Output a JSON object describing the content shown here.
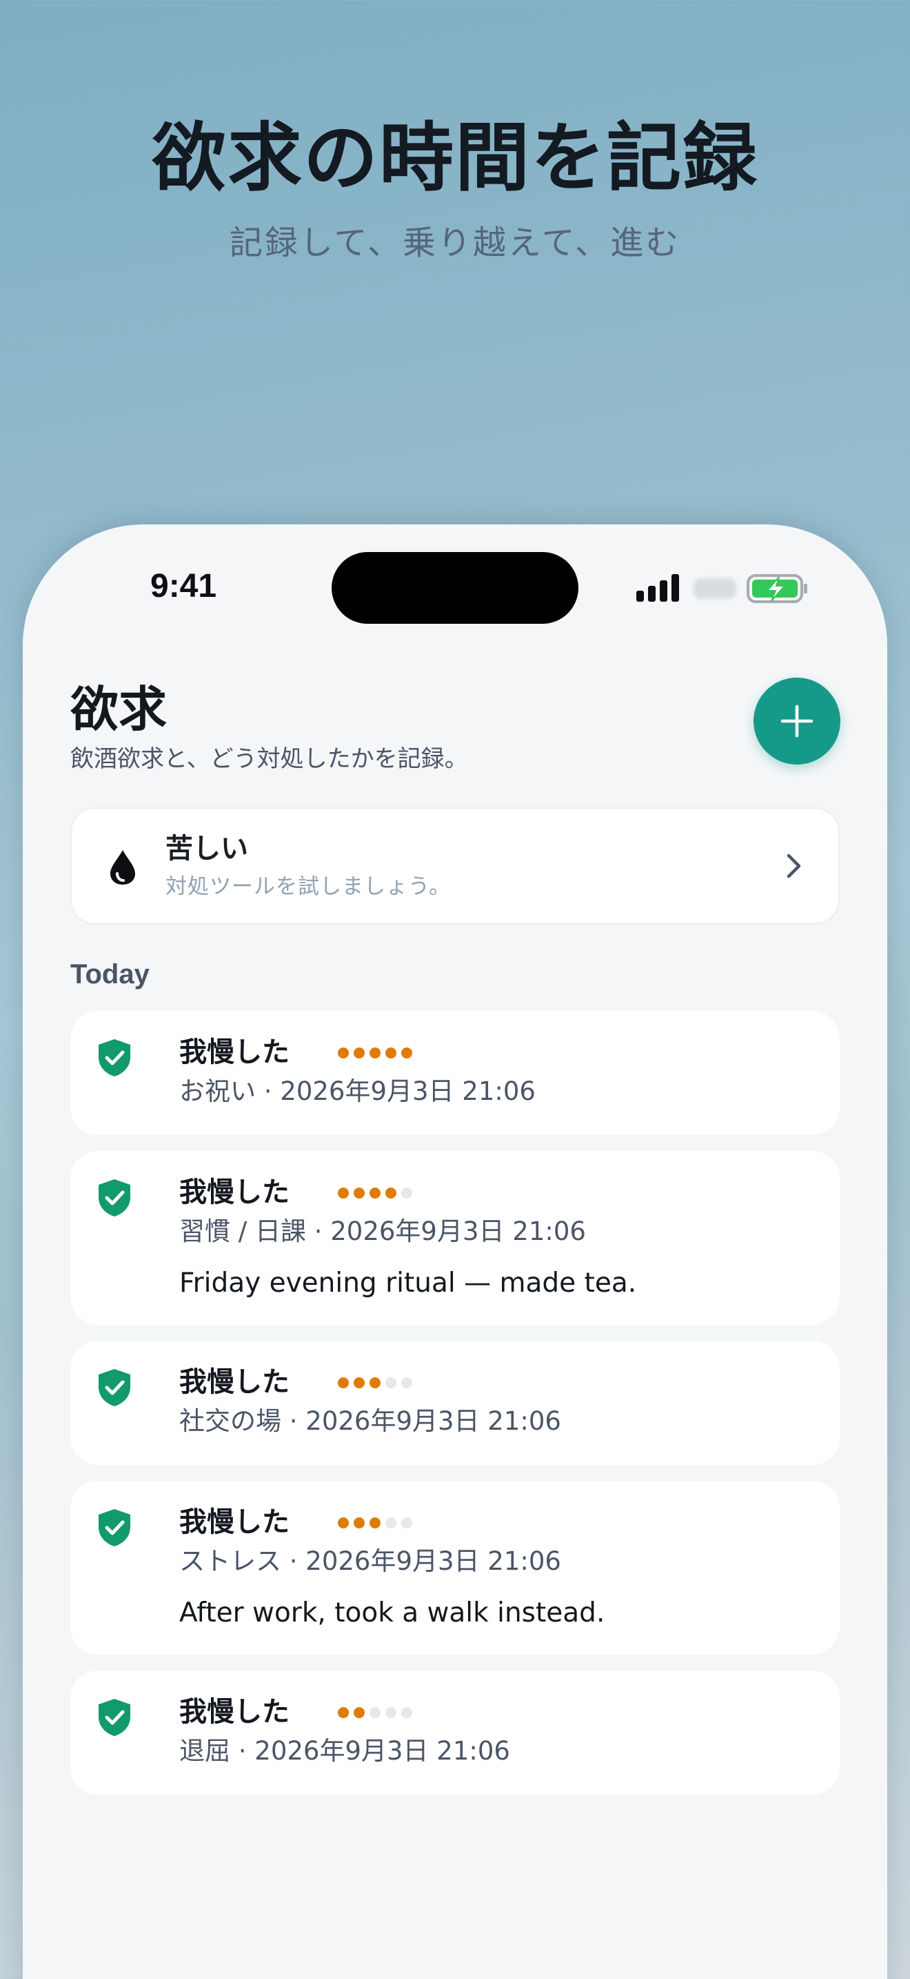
{
  "hero": {
    "title": "欲求の時間を記録",
    "subtitle": "記録して、乗り越えて、進む"
  },
  "status_bar": {
    "time": "9:41"
  },
  "header": {
    "title": "欲求",
    "description": "飲酒欲求と、どう対処したかを記録。",
    "add_icon": "plus-icon"
  },
  "state_card": {
    "icon": "drop-icon",
    "label": "苦しい",
    "hint": "対処ツールを試しましょう。",
    "chevron_icon": "chevron-right-icon"
  },
  "section": {
    "today": "Today"
  },
  "entries": [
    {
      "outcome": "我慢した",
      "intensity": 5,
      "meta": "お祝い · 2026年9月3日 21:06",
      "note": ""
    },
    {
      "outcome": "我慢した",
      "intensity": 4,
      "meta": "習慣 / 日課 · 2026年9月3日 21:06",
      "note": "Friday evening ritual — made tea."
    },
    {
      "outcome": "我慢した",
      "intensity": 3,
      "meta": "社交の場 · 2026年9月3日 21:06",
      "note": ""
    },
    {
      "outcome": "我慢した",
      "intensity": 3,
      "meta": "ストレス · 2026年9月3日 21:06",
      "note": "After work, took a walk instead."
    },
    {
      "outcome": "我慢した",
      "intensity": 2,
      "meta": "退屈 · 2026年9月3日 21:06",
      "note": ""
    }
  ],
  "intensity_max": 5,
  "colors": {
    "accent": "#159a89",
    "shield": "#119a6a",
    "intensity_on": "#e07b00",
    "intensity_off": "#e6e8eb"
  }
}
